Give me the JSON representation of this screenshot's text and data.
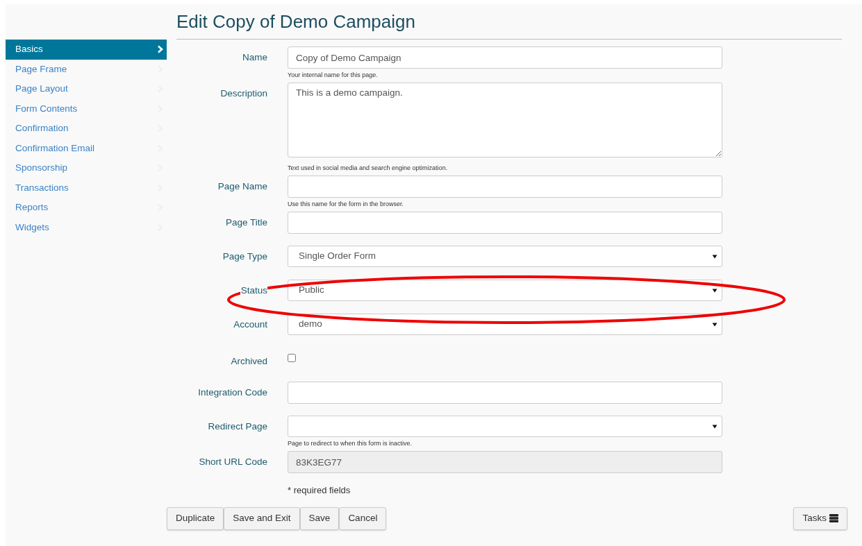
{
  "title": "Edit Copy of Demo Campaign",
  "sidebar": {
    "items": [
      {
        "label": "Basics",
        "selected": true
      },
      {
        "label": "Page Frame",
        "selected": false
      },
      {
        "label": "Page Layout",
        "selected": false
      },
      {
        "label": "Form Contents",
        "selected": false
      },
      {
        "label": "Confirmation",
        "selected": false
      },
      {
        "label": "Confirmation Email",
        "selected": false
      },
      {
        "label": "Sponsorship",
        "selected": false
      },
      {
        "label": "Transactions",
        "selected": false
      },
      {
        "label": "Reports",
        "selected": false
      },
      {
        "label": "Widgets",
        "selected": false
      }
    ]
  },
  "fields": [
    {
      "kind": "text",
      "label": "Name",
      "value": "Copy of Demo Campaign",
      "help": "Your internal name for this page."
    },
    {
      "kind": "textarea",
      "label": "Description",
      "value": "This is a demo campaign.",
      "help": "Text used in social media and search engine optimization."
    },
    {
      "kind": "text",
      "label": "Page Name",
      "help": "Use this name for the form in the browser."
    },
    {
      "kind": "text",
      "label": "Page Title"
    },
    {
      "kind": "select",
      "label": "Page Type",
      "value": "Single Order Form"
    },
    {
      "kind": "select",
      "label": "Status",
      "value": "Public",
      "annotated": true
    },
    {
      "kind": "select",
      "label": "Account",
      "value": "demo"
    },
    {
      "kind": "checkbox",
      "label": "Archived",
      "checked": false
    },
    {
      "kind": "text",
      "label": "Integration Code"
    },
    {
      "kind": "select",
      "label": "Redirect Page",
      "help": "Page to redirect to when this form is inactive."
    },
    {
      "kind": "text",
      "label": "Short URL Code",
      "value": "83K3EG77",
      "disabled": true
    }
  ],
  "required_note": "* required fields",
  "buttons": [
    "Duplicate",
    "Save and Exit",
    "Save",
    "Cancel"
  ],
  "tasks_button": "Tasks"
}
